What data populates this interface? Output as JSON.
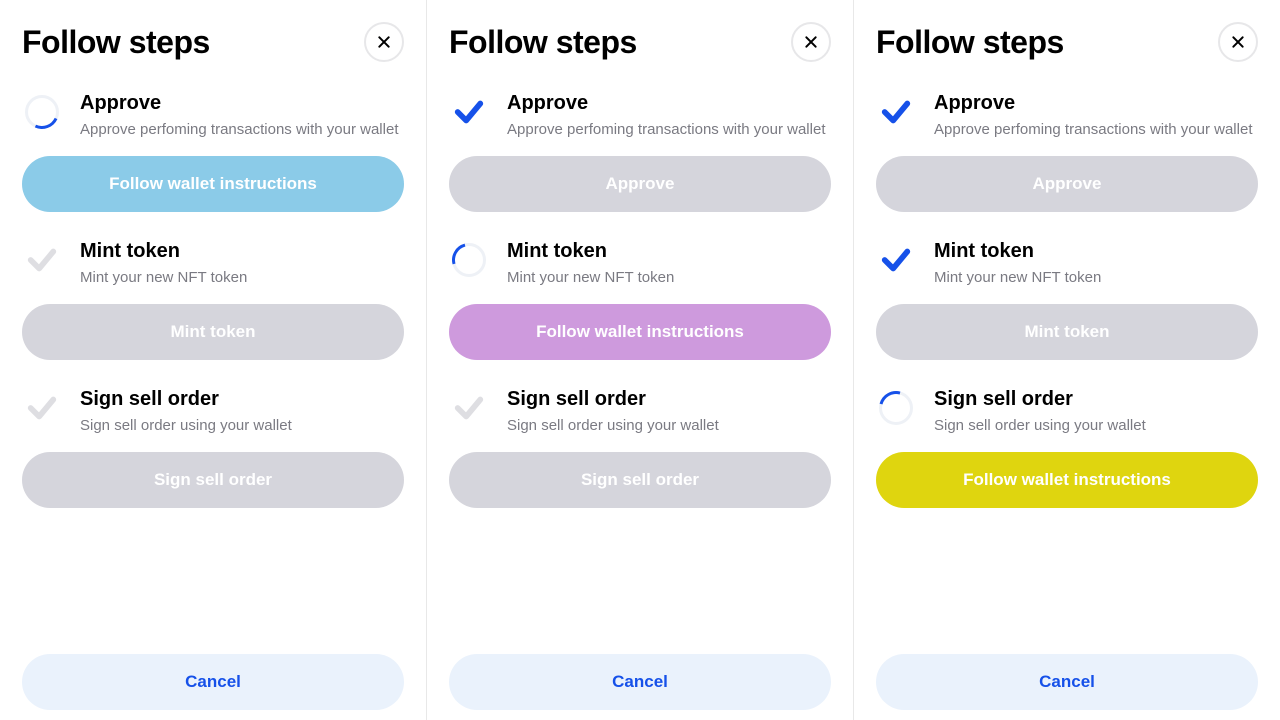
{
  "common": {
    "modal_title": "Follow steps",
    "cancel_label": "Cancel",
    "follow_wallet_label": "Follow wallet instructions",
    "steps": {
      "approve": {
        "title": "Approve",
        "desc": "Approve perfoming transactions with your wallet",
        "button": "Approve"
      },
      "mint": {
        "title": "Mint token",
        "desc": "Mint your new NFT token",
        "button": "Mint token"
      },
      "sign": {
        "title": "Sign sell order",
        "desc": "Sign sell order using your wallet",
        "button": "Sign sell order"
      }
    }
  }
}
